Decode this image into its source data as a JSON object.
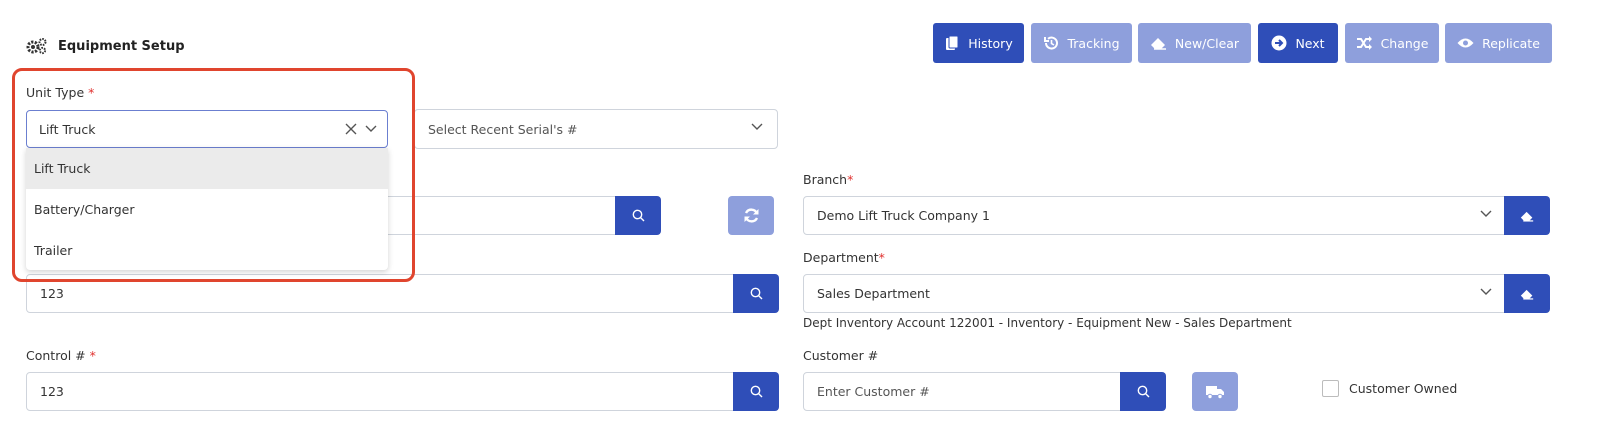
{
  "header": {
    "title": "Equipment Setup",
    "buttons": {
      "history": "History",
      "tracking": "Tracking",
      "new_clear": "New/Clear",
      "next": "Next",
      "change": "Change",
      "replicate": "Replicate"
    }
  },
  "unit_type": {
    "label": "Unit Type",
    "required": "*",
    "value": "Lift Truck",
    "options": [
      "Lift Truck",
      "Battery/Charger",
      "Trailer"
    ]
  },
  "recent_serial": {
    "placeholder": "Select Recent Serial's #"
  },
  "stock_field": {
    "value": "123"
  },
  "control": {
    "label": "Control #",
    "required": "*",
    "value": "123"
  },
  "branch": {
    "label": "Branch",
    "required": "*",
    "value": "Demo Lift Truck Company 1"
  },
  "department": {
    "label": "Department",
    "required": "*",
    "value": "Sales Department",
    "note": "Dept Inventory Account 122001 - Inventory - Equipment New - Sales Department"
  },
  "customer": {
    "label": "Customer #",
    "placeholder": "Enter Customer #",
    "owned_label": "Customer Owned"
  },
  "colors": {
    "primary": "#2f4eb8",
    "primary_light": "#8e9fdc",
    "highlight": "#e0452e",
    "required": "#e0302e"
  },
  "icons": [
    "gears-icon",
    "history-icon",
    "tracking-icon",
    "eraser-icon",
    "arrow-right-icon",
    "shuffle-icon",
    "eye-icon",
    "search-icon",
    "refresh-icon",
    "truck-icon",
    "chevron-down-icon",
    "clear-x-icon"
  ]
}
